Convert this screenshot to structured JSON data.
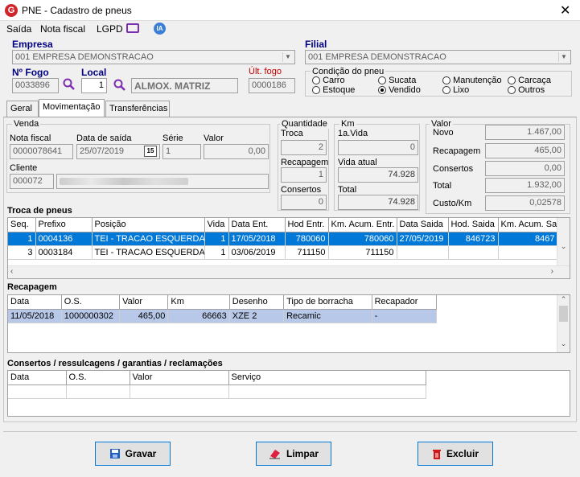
{
  "window": {
    "title": "PNE - Cadastro de pneus"
  },
  "menu": {
    "saida": "Saída",
    "nota_fiscal": "Nota fiscal",
    "lgpd": "LGPD",
    "ia": "IA"
  },
  "empresa": {
    "label": "Empresa",
    "value": "001 EMPRESA DEMONSTRACAO"
  },
  "filial": {
    "label": "Filial",
    "value": "001 EMPRESA DEMONSTRACAO"
  },
  "fogo": {
    "label": "Nº Fogo",
    "value": "0033896"
  },
  "local": {
    "label": "Local",
    "value": "1",
    "name": "ALMOX. MATRIZ"
  },
  "ult_fogo": {
    "label": "Últ. fogo",
    "value": "0000186"
  },
  "condicao": {
    "title": "Condição do pneu",
    "options": [
      "Carro",
      "Sucata",
      "Manutenção",
      "Carcaça",
      "Estoque",
      "Vendido",
      "Lixo",
      "Outros"
    ],
    "selected": "Vendido"
  },
  "tabs": [
    "Geral",
    "Movimentação",
    "Transferências"
  ],
  "venda": {
    "title": "Venda",
    "nota_fiscal_label": "Nota fiscal",
    "nota_fiscal": "0000078641",
    "data_saida_label": "Data de saída",
    "data_saida": "25/07/2019",
    "serie_label": "Série",
    "serie": "1",
    "valor_label": "Valor",
    "valor": "0,00",
    "cliente_label": "Cliente",
    "cliente": "000072"
  },
  "quantidade": {
    "title": "Quantidade",
    "troca_label": "Troca",
    "troca": "2",
    "recapagem_label": "Recapagem",
    "recapagem": "1",
    "consertos_label": "Consertos",
    "consertos": "0"
  },
  "km": {
    "title": "Km",
    "vida1_label": "1a.Vida",
    "vida1": "0",
    "vida_atual_label": "Vida atual",
    "vida_atual": "74.928",
    "total_label": "Total",
    "total": "74.928"
  },
  "valor": {
    "title": "Valor",
    "novo_label": "Novo",
    "novo": "1.467,00",
    "recapagem_label": "Recapagem",
    "recapagem": "465,00",
    "consertos_label": "Consertos",
    "consertos": "0,00",
    "total_label": "Total",
    "total": "1.932,00",
    "custo_km_label": "Custo/Km",
    "custo_km": "0,02578"
  },
  "troca": {
    "title": "Troca de pneus",
    "columns": [
      "Seq.",
      "Prefixo",
      "Posição",
      "Vida",
      "Data Ent.",
      "Hod Entr.",
      "Km. Acum. Entr.",
      "Data Saida",
      "Hod. Saida",
      "Km. Acum. Sa"
    ],
    "rows": [
      [
        "1",
        "0004136",
        "TEI - TRACAO ESQUERDA",
        "1",
        "17/05/2018",
        "780060",
        "780060",
        "27/05/2019",
        "846723",
        "8467"
      ],
      [
        "3",
        "0003184",
        "TEI - TRACAO ESQUERDA",
        "1",
        "03/06/2019",
        "711150",
        "711150",
        "",
        "",
        ""
      ]
    ]
  },
  "recapagem": {
    "title": "Recapagem",
    "columns": [
      "Data",
      "O.S.",
      "Valor",
      "Km",
      "Desenho",
      "Tipo de borracha",
      "Recapador"
    ],
    "rows": [
      [
        "11/05/2018",
        "1000000302",
        "465,00",
        "66663",
        "XZE 2",
        "Recamic",
        "-"
      ]
    ]
  },
  "consertos": {
    "title": "Consertos / ressulcagens / garantias / reclamações",
    "columns": [
      "Data",
      "O.S.",
      "Valor",
      "Serviço"
    ]
  },
  "buttons": {
    "gravar": "Gravar",
    "limpar": "Limpar",
    "excluir": "Excluir"
  },
  "colors": {
    "accent": "#0078d7",
    "label_blue": "#000080",
    "red_label": "#c00000"
  }
}
